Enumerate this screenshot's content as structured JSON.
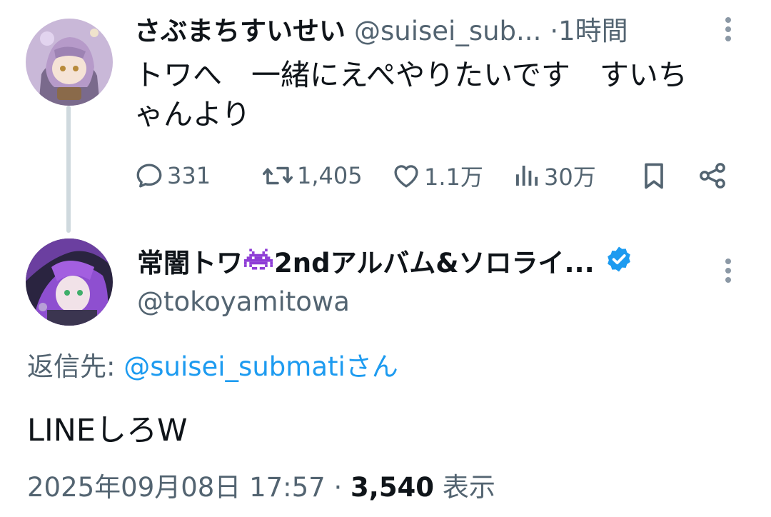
{
  "tweet1": {
    "display_name": "さぶまちすいせい",
    "handle": "@suisei_sub...",
    "separator": "·",
    "time": "1時間",
    "text": "トワへ　一緒にえぺやりたいです　すいち\nゃんより",
    "stats": {
      "replies": "331",
      "retweets": "1,405",
      "likes": "1.1万",
      "views": "30万"
    },
    "icons": {
      "more": "more-vertical-icon",
      "reply": "comment-icon",
      "retweet": "retweet-icon",
      "like": "heart-icon",
      "views": "bar-chart-icon",
      "bookmark": "bookmark-icon",
      "share": "share-icon"
    }
  },
  "tweet2": {
    "display_name_prefix": "常闇トワ",
    "display_name_suffix": "2ndアルバム&ソロライ...",
    "emoji": "👾",
    "handle": "@tokoyamitowa",
    "verified": true,
    "reply_to_label": "返信先: ",
    "reply_to_handle": "@suisei_submatiさん",
    "text": "LINEしろW",
    "timestamp": "2025年09月08日 17:57",
    "separator": " · ",
    "views_count": "3,540",
    "views_label": " 表示"
  },
  "colors": {
    "text_primary": "#0f1419",
    "text_secondary": "#536471",
    "link": "#1d9bf0",
    "thread_line": "#cfd9de",
    "emoji_purple": "#8e3dd6"
  }
}
